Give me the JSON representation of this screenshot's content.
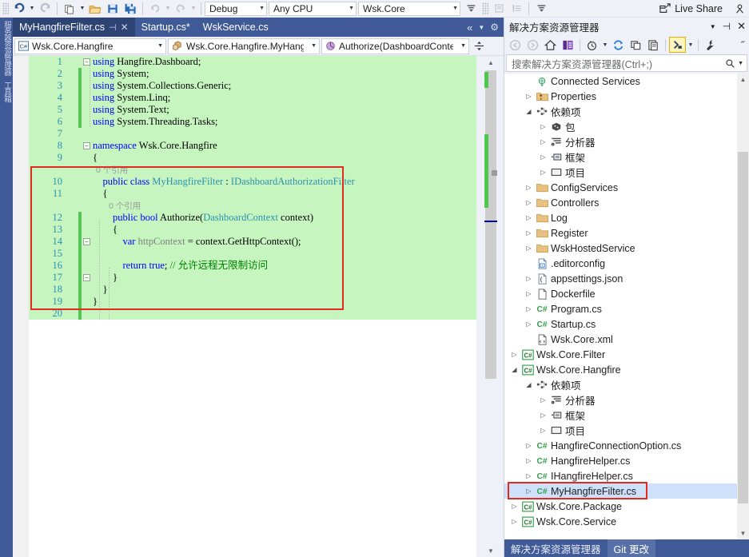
{
  "toolbar": {
    "config_combo": "Debug",
    "platform_combo": "Any CPU",
    "startup_combo": "Wsk.Core",
    "live_share": "Live Share",
    "icons": [
      "undo-icon",
      "undo-dropdown-icon",
      "redo-icon",
      "new-project-icon",
      "new-project-dropdown-icon",
      "open-file-icon",
      "save-icon",
      "save-all-icon",
      "undo-arrow-icon",
      "undo-arrow-dropdown-icon",
      "redo-arrow-icon",
      "redo-arrow-dropdown-icon",
      "navigate-backward-icon",
      "comment-icon",
      "uncomment-icon",
      "indent-icon",
      "outdent-icon",
      "live-share-icon",
      "account-icon"
    ]
  },
  "left_dock": {
    "tabs": [
      "服务器资源管理器",
      "工具箱"
    ]
  },
  "editor": {
    "tabs": [
      {
        "label": "MyHangfireFilter.cs",
        "active": true,
        "pin": "⊣",
        "close": "✕"
      },
      {
        "label": "Startup.cs*",
        "active": false
      },
      {
        "label": "WskService.cs",
        "active": false
      }
    ],
    "tabstrip_icons": [
      "chevron-double-left-icon",
      "tab-list-dropdown-icon",
      "tab-settings-gear-icon"
    ],
    "navbar": {
      "project_combo": "Wsk.Core.Hangfire",
      "type_combo": "Wsk.Core.Hangfire.MyHang",
      "member_combo": "Authorize(DashboardConte",
      "split_icon": "split-editor-icon"
    },
    "lines": [
      {
        "n": "1",
        "lens": null,
        "segs": [
          {
            "c": "k",
            "t": "using "
          },
          {
            "c": "pl",
            "t": "Hangfire.Dashboard;"
          }
        ]
      },
      {
        "n": "2",
        "lens": null,
        "segs": [
          {
            "c": "k",
            "t": "using "
          },
          {
            "c": "pl",
            "t": "System;"
          }
        ]
      },
      {
        "n": "3",
        "lens": null,
        "segs": [
          {
            "c": "k",
            "t": "using "
          },
          {
            "c": "pl",
            "t": "System.Collections.Generic;"
          }
        ]
      },
      {
        "n": "4",
        "lens": null,
        "segs": [
          {
            "c": "k",
            "t": "using "
          },
          {
            "c": "pl",
            "t": "System.Linq;"
          }
        ]
      },
      {
        "n": "5",
        "lens": null,
        "segs": [
          {
            "c": "k",
            "t": "using "
          },
          {
            "c": "pl",
            "t": "System.Text;"
          }
        ]
      },
      {
        "n": "6",
        "lens": null,
        "segs": [
          {
            "c": "k",
            "t": "using "
          },
          {
            "c": "pl",
            "t": "System.Threading.Tasks;"
          }
        ]
      },
      {
        "n": "7",
        "lens": null,
        "segs": []
      },
      {
        "n": "8",
        "lens": null,
        "segs": [
          {
            "c": "k",
            "t": "namespace "
          },
          {
            "c": "pl",
            "t": "Wsk.Core.Hangfire"
          }
        ]
      },
      {
        "n": "9",
        "lens": null,
        "segs": [
          {
            "c": "pl",
            "t": "{"
          }
        ]
      },
      {
        "n": "10",
        "lens": "0 个引用",
        "segs": [
          {
            "c": "pl",
            "t": "    "
          },
          {
            "c": "k",
            "t": "public class "
          },
          {
            "c": "t",
            "t": "MyHangfireFilter"
          },
          {
            "c": "pl",
            "t": " : "
          },
          {
            "c": "t",
            "t": "IDashboardAuthorizationFilter"
          }
        ]
      },
      {
        "n": "11",
        "lens": null,
        "segs": [
          {
            "c": "pl",
            "t": "    {"
          }
        ]
      },
      {
        "n": "12",
        "lens": "0 个引用",
        "segs": [
          {
            "c": "pl",
            "t": "        "
          },
          {
            "c": "k",
            "t": "public bool "
          },
          {
            "c": "pl",
            "t": "Authorize("
          },
          {
            "c": "t",
            "t": "DashboardContext"
          },
          {
            "c": "pl",
            "t": " context)"
          }
        ]
      },
      {
        "n": "13",
        "lens": null,
        "segs": [
          {
            "c": "pl",
            "t": "        {"
          }
        ]
      },
      {
        "n": "14",
        "lens": null,
        "segs": [
          {
            "c": "pl",
            "t": "            "
          },
          {
            "c": "k",
            "t": "var "
          },
          {
            "c": "lv",
            "t": "httpContext"
          },
          {
            "c": "pl",
            "t": " = context.GetHttpContext();"
          }
        ]
      },
      {
        "n": "15",
        "lens": null,
        "segs": []
      },
      {
        "n": "16",
        "lens": null,
        "segs": [
          {
            "c": "pl",
            "t": "            "
          },
          {
            "c": "k",
            "t": "return true"
          },
          {
            "c": "pl",
            "t": "; "
          },
          {
            "c": "cm",
            "t": "// 允许远程无限制访问"
          }
        ]
      },
      {
        "n": "17",
        "lens": null,
        "segs": [
          {
            "c": "pl",
            "t": "        }"
          }
        ]
      },
      {
        "n": "18",
        "lens": null,
        "segs": [
          {
            "c": "pl",
            "t": "    }"
          }
        ]
      },
      {
        "n": "19",
        "lens": null,
        "segs": [
          {
            "c": "pl",
            "t": "}"
          }
        ]
      },
      {
        "n": "20",
        "lens": null,
        "segs": []
      }
    ]
  },
  "solution_explorer": {
    "title": "解决方案资源管理器",
    "header_icons": [
      "dropdown-icon",
      "pin-icon",
      "close-icon"
    ],
    "toolbar_icons": [
      "back-icon",
      "forward-icon",
      "home-icon",
      "switch-views-icon",
      "pending-changes-icon",
      "pending-changes-dropdown-icon",
      "refresh-icon",
      "collapse-all-icon",
      "show-all-files-icon",
      "properties-icon",
      "properties-dropdown-icon",
      "wrench-icon",
      "overflow-icon"
    ],
    "search_placeholder": "搜索解决方案资源管理器(Ctrl+;)",
    "search_icons": [
      "search-icon",
      "search-dropdown-icon"
    ],
    "tree": [
      {
        "label": "Connected Services",
        "indent": 1,
        "arrow": "",
        "icon": "connected-services-icon"
      },
      {
        "label": "Properties",
        "indent": 1,
        "arrow": "▷",
        "icon": "properties-folder-icon"
      },
      {
        "label": "依赖项",
        "indent": 1,
        "arrow": "◢",
        "icon": "dependencies-icon"
      },
      {
        "label": "包",
        "indent": 2,
        "arrow": "▷",
        "icon": "packages-icon"
      },
      {
        "label": "分析器",
        "indent": 2,
        "arrow": "▷",
        "icon": "analyzers-icon"
      },
      {
        "label": "框架",
        "indent": 2,
        "arrow": "▷",
        "icon": "frameworks-icon"
      },
      {
        "label": "项目",
        "indent": 2,
        "arrow": "▷",
        "icon": "projects-dep-icon"
      },
      {
        "label": "ConfigServices",
        "indent": 1,
        "arrow": "▷",
        "icon": "folder-icon"
      },
      {
        "label": "Controllers",
        "indent": 1,
        "arrow": "▷",
        "icon": "folder-icon"
      },
      {
        "label": "Log",
        "indent": 1,
        "arrow": "▷",
        "icon": "folder-icon"
      },
      {
        "label": "Register",
        "indent": 1,
        "arrow": "▷",
        "icon": "folder-icon"
      },
      {
        "label": "WskHostedService",
        "indent": 1,
        "arrow": "▷",
        "icon": "folder-icon"
      },
      {
        "label": ".editorconfig",
        "indent": 1,
        "arrow": "",
        "icon": "editorconfig-icon"
      },
      {
        "label": "appsettings.json",
        "indent": 1,
        "arrow": "▷",
        "icon": "json-icon"
      },
      {
        "label": "Dockerfile",
        "indent": 1,
        "arrow": "▷",
        "icon": "file-icon"
      },
      {
        "label": "Program.cs",
        "indent": 1,
        "arrow": "▷",
        "icon": "csharp-file-icon"
      },
      {
        "label": "Startup.cs",
        "indent": 1,
        "arrow": "▷",
        "icon": "csharp-file-icon"
      },
      {
        "label": "Wsk.Core.xml",
        "indent": 1,
        "arrow": "",
        "icon": "xml-icon"
      },
      {
        "label": "Wsk.Core.Filter",
        "indent": 0,
        "arrow": "▷",
        "icon": "csharp-project-icon"
      },
      {
        "label": "Wsk.Core.Hangfire",
        "indent": 0,
        "arrow": "◢",
        "icon": "csharp-project-icon"
      },
      {
        "label": "依赖项",
        "indent": 1,
        "arrow": "◢",
        "icon": "dependencies-icon"
      },
      {
        "label": "分析器",
        "indent": 2,
        "arrow": "▷",
        "icon": "analyzers-icon"
      },
      {
        "label": "框架",
        "indent": 2,
        "arrow": "▷",
        "icon": "frameworks-icon"
      },
      {
        "label": "项目",
        "indent": 2,
        "arrow": "▷",
        "icon": "projects-dep-icon"
      },
      {
        "label": "HangfireConnectionOption.cs",
        "indent": 1,
        "arrow": "▷",
        "icon": "csharp-file-icon"
      },
      {
        "label": "HangfireHelper.cs",
        "indent": 1,
        "arrow": "▷",
        "icon": "csharp-file-icon"
      },
      {
        "label": "IHangfireHelper.cs",
        "indent": 1,
        "arrow": "▷",
        "icon": "csharp-file-icon"
      },
      {
        "label": "MyHangfireFilter.cs",
        "indent": 1,
        "arrow": "▷",
        "icon": "csharp-file-icon",
        "selected": true,
        "highlighted": true
      },
      {
        "label": "Wsk.Core.Package",
        "indent": 0,
        "arrow": "▷",
        "icon": "csharp-project-icon"
      },
      {
        "label": "Wsk.Core.Service",
        "indent": 0,
        "arrow": "▷",
        "icon": "csharp-project-icon"
      }
    ],
    "footer_tabs": [
      {
        "label": "解决方案资源管理器",
        "active": false
      },
      {
        "label": "Git 更改",
        "active": true
      }
    ]
  },
  "colors": {
    "accent_blue": "#3f5a96",
    "code_bg_green": "#c6f5c0",
    "annotation_red": "#e02b20",
    "selection_blue": "#cfe0fb",
    "changebar_green": "#57c457"
  }
}
